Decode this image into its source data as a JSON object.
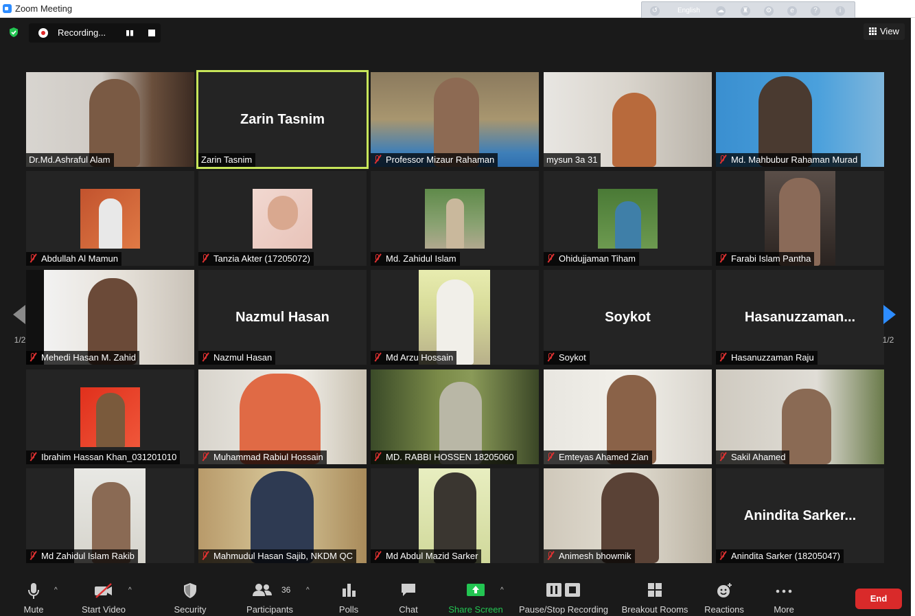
{
  "window": {
    "title": "Zoom Meeting"
  },
  "translator": {
    "language": "English"
  },
  "recording": {
    "label": "Recording..."
  },
  "view": {
    "label": "View"
  },
  "pagination": {
    "left": "1/2",
    "right": "1/2"
  },
  "colors": {
    "active_speaker": "#c8e65a",
    "accent": "#2d8cff",
    "share_green": "#23c552",
    "end_red": "#d92a2a",
    "muted_red": "#e03131"
  },
  "participants": [
    {
      "name": "Dr.Md.Ashraful Alam",
      "muted": false,
      "display": ""
    },
    {
      "name": "Zarin Tasnim",
      "muted": false,
      "display": "Zarin Tasnim",
      "active": true
    },
    {
      "name": "Professor Mizaur Rahaman",
      "muted": true,
      "display": ""
    },
    {
      "name": "mysun 3a 31",
      "muted": false,
      "display": ""
    },
    {
      "name": "Md. Mahbubur Rahaman Murad",
      "muted": true,
      "display": ""
    },
    {
      "name": "Abdullah Al Mamun",
      "muted": true,
      "display": ""
    },
    {
      "name": "Tanzia Akter (17205072)",
      "muted": true,
      "display": ""
    },
    {
      "name": "Md. Zahidul Islam",
      "muted": true,
      "display": ""
    },
    {
      "name": "Ohidujjaman Tiham",
      "muted": true,
      "display": ""
    },
    {
      "name": "Farabi Islam Pantha",
      "muted": true,
      "display": ""
    },
    {
      "name": "Mehedi Hasan M. Zahid",
      "muted": true,
      "display": ""
    },
    {
      "name": "Nazmul Hasan",
      "muted": true,
      "display": "Nazmul Hasan"
    },
    {
      "name": "Md Arzu Hossain",
      "muted": true,
      "display": ""
    },
    {
      "name": "Soykot",
      "muted": true,
      "display": "Soykot"
    },
    {
      "name": "Hasanuzzaman Raju",
      "muted": true,
      "display": "Hasanuzzaman..."
    },
    {
      "name": "Ibrahim Hassan Khan_031201010",
      "muted": true,
      "display": ""
    },
    {
      "name": "Muhammad Rabiul Hossain",
      "muted": true,
      "display": ""
    },
    {
      "name": "MD. RABBI HOSSEN 18205060",
      "muted": true,
      "display": ""
    },
    {
      "name": "Emteyas Ahamed Zian",
      "muted": true,
      "display": ""
    },
    {
      "name": "Sakil Ahamed",
      "muted": true,
      "display": ""
    },
    {
      "name": "Md Zahidul Islam Rakib",
      "muted": true,
      "display": ""
    },
    {
      "name": "Mahmudul Hasan Sajib, NKDM QC",
      "muted": true,
      "display": ""
    },
    {
      "name": "Md Abdul Mazid Sarker",
      "muted": true,
      "display": ""
    },
    {
      "name": "Animesh bhowmik",
      "muted": true,
      "display": ""
    },
    {
      "name": "Anindita Sarker (18205047)",
      "muted": true,
      "display": "Anindita Sarker..."
    }
  ],
  "toolbar": {
    "mute": "Mute",
    "start_video": "Start Video",
    "security": "Security",
    "participants": "Participants",
    "participants_count": "36",
    "polls": "Polls",
    "chat": "Chat",
    "share_screen": "Share Screen",
    "pause_stop_recording": "Pause/Stop Recording",
    "breakout_rooms": "Breakout Rooms",
    "reactions": "Reactions",
    "more": "More",
    "end": "End"
  }
}
